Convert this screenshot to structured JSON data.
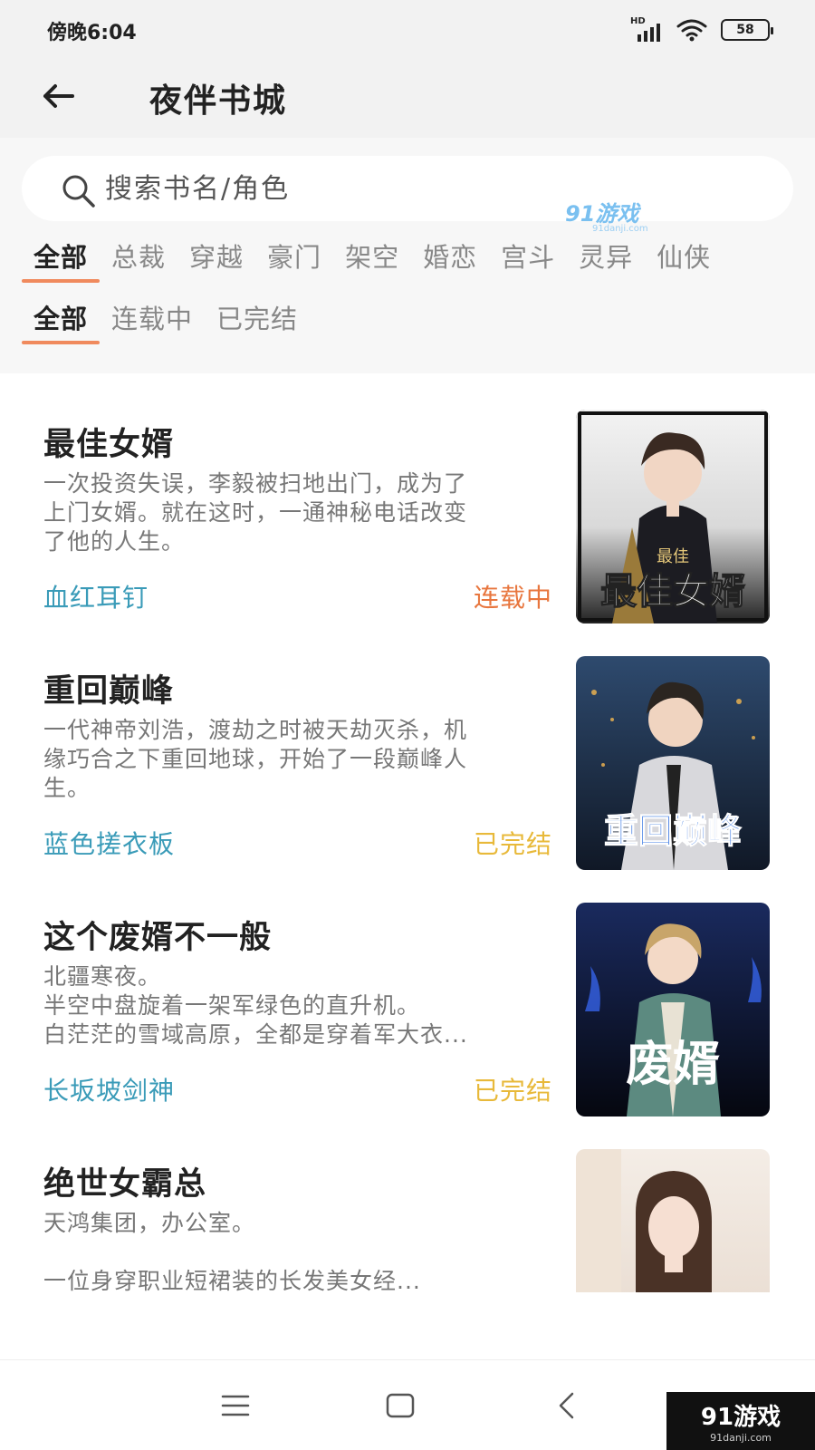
{
  "status_bar": {
    "time": "傍晚6:04",
    "network": "HD",
    "battery": "58"
  },
  "header": {
    "title": "夜伴书城"
  },
  "search": {
    "placeholder": "搜索书名/角色"
  },
  "watermark": {
    "brand": "91游戏",
    "domain": "91danji.com"
  },
  "genres": {
    "items": [
      {
        "label": "全部",
        "active": true
      },
      {
        "label": "总裁"
      },
      {
        "label": "穿越"
      },
      {
        "label": "豪门"
      },
      {
        "label": "架空"
      },
      {
        "label": "婚恋"
      },
      {
        "label": "宫斗"
      },
      {
        "label": "灵异"
      },
      {
        "label": "仙侠"
      }
    ]
  },
  "status_filter": {
    "items": [
      {
        "label": "全部",
        "active": true
      },
      {
        "label": "连载中"
      },
      {
        "label": "已完结"
      }
    ]
  },
  "books": [
    {
      "title": "最佳女婿",
      "description": "一次投资失误，李毅被扫地出门，成为了\n上门女婿。就在这时，一通神秘电话改变\n了他的人生。",
      "author": "血红耳钉",
      "status": "连载中",
      "status_color": "#e8763e",
      "cover": {
        "top_text": "最佳",
        "main_text": "最佳女婿"
      }
    },
    {
      "title": "重回巅峰",
      "description": "一代神帝刘浩，渡劫之时被天劫灭杀，机\n缘巧合之下重回地球，开始了一段巅峰人\n生。",
      "author": "蓝色搓衣板",
      "status": "已完结",
      "status_color": "#e8b93a",
      "cover": {
        "main_text": "重回巅峰"
      }
    },
    {
      "title": "这个废婿不一般",
      "description": "北疆寒夜。\n半空中盘旋着一架军绿色的直升机。\n白茫茫的雪域高原，全都是穿着军大衣...",
      "author": "长坂坡剑神",
      "status": "已完结",
      "status_color": "#e8b93a",
      "cover": {
        "main_text": "废婿"
      }
    },
    {
      "title": "绝世女霸总",
      "description": "天鸿集团，办公室。\n\n    一位身穿职业短裙装的长发美女经...",
      "author": "",
      "status": "",
      "status_color": "#e8b93a",
      "cover": {}
    }
  ],
  "icons": {
    "back": "arrow-left-icon",
    "search": "magnifier-icon",
    "menu": "menu-icon",
    "home": "square-home-icon",
    "nav_back": "chevron-left-icon"
  }
}
